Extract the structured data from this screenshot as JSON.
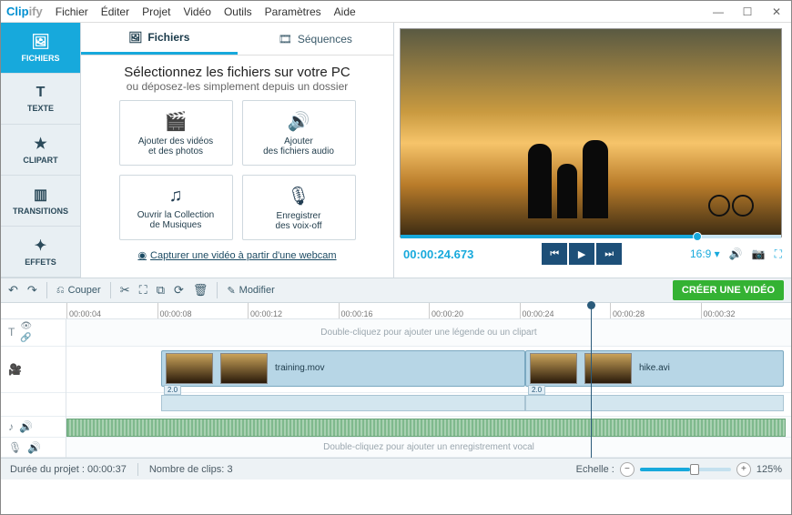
{
  "app": {
    "name1": "Clip",
    "name2": "ify"
  },
  "menus": [
    "Fichier",
    "Éditer",
    "Projet",
    "Vidéo",
    "Outils",
    "Paramètres",
    "Aide"
  ],
  "win": {
    "min": "—",
    "max": "☐",
    "close": "✕"
  },
  "left_tabs": [
    {
      "label": "FICHIERS",
      "icon": "🖼"
    },
    {
      "label": "TEXTE",
      "icon": "T"
    },
    {
      "label": "CLIPART",
      "icon": "★"
    },
    {
      "label": "TRANSITIONS",
      "icon": "▥"
    },
    {
      "label": "EFFETS",
      "icon": "✦"
    }
  ],
  "mid": {
    "tab_files": "Fichiers",
    "tab_seq": "Séquences",
    "title": "Sélectionnez les fichiers sur votre PC",
    "sub": "ou déposez-les simplement depuis un dossier",
    "tiles": [
      {
        "icon": "🎬",
        "line1": "Ajouter des vidéos",
        "line2": "et des photos"
      },
      {
        "icon": "🔊",
        "line1": "Ajouter",
        "line2": "des fichiers audio"
      },
      {
        "icon": "♫",
        "line1": "Ouvrir la Collection",
        "line2": "de Musiques"
      },
      {
        "icon": "🎙",
        "line1": "Enregistrer",
        "line2": "des voix-off"
      }
    ],
    "webcam": "Capturer une vidéo à partir d'une webcam"
  },
  "preview": {
    "timecode": "00:00:24.673",
    "aspect": "16:9 ▾"
  },
  "toolbar": {
    "couper": "Couper",
    "modifier": "Modifier",
    "create": "CRÉER UNE VIDÉO"
  },
  "ruler": [
    "00:00:04",
    "00:00:08",
    "00:00:12",
    "00:00:16",
    "00:00:20",
    "00:00:24",
    "00:00:28",
    "00:00:32"
  ],
  "lanes": {
    "text_hint": "Double-cliquez pour ajouter une légende ou un clipart",
    "vocal_hint": "Double-cliquez pour ajouter un enregistrement vocal",
    "clip1": {
      "name": "training.mov",
      "speed": "2.0"
    },
    "clip2": {
      "name": "hike.avi",
      "speed": "2.0"
    }
  },
  "status": {
    "duration_label": "Durée du projet :",
    "duration": "00:00:37",
    "clips_label": "Nombre de clips:",
    "clips": "3",
    "scale_label": "Echelle :",
    "zoom": "125%"
  }
}
